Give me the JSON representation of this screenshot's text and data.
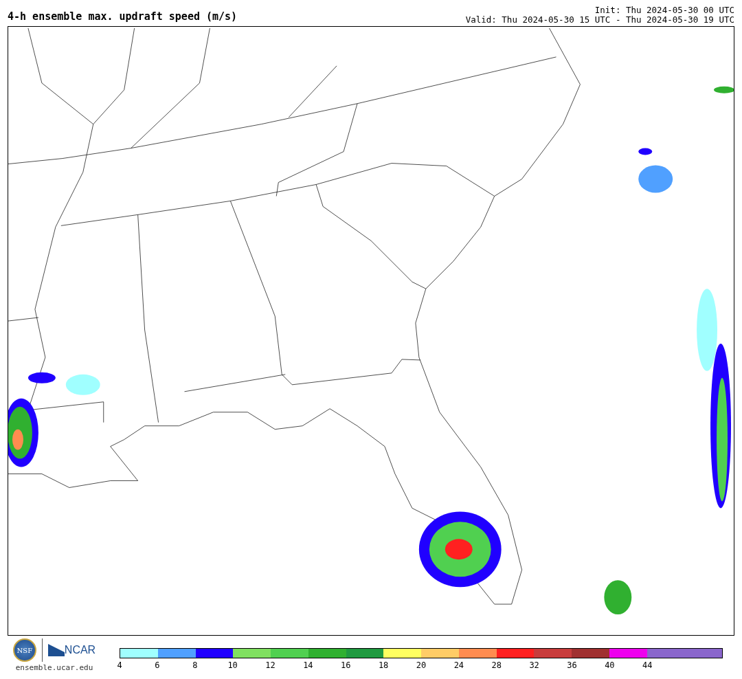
{
  "title": "4-h ensemble max. updraft speed (m/s)",
  "init": "Init: Thu 2024-05-30 00 UTC",
  "valid": "Valid: Thu 2024-05-30 15 UTC - Thu 2024-05-30 19 UTC",
  "footer": {
    "nsf_logo": "NSF",
    "ncar_logo": "NCAR",
    "url": "ensemble.ucar.edu"
  },
  "colorbar": [
    {
      "color": "#a0ffff",
      "label": "4"
    },
    {
      "color": "#50a0ff",
      "label": "6"
    },
    {
      "color": "#2000ff",
      "label": "8"
    },
    {
      "color": "#80e060",
      "label": "10"
    },
    {
      "color": "#50d050",
      "label": "12"
    },
    {
      "color": "#30b030",
      "label": "14"
    },
    {
      "color": "#209a40",
      "label": "16"
    },
    {
      "color": "#ffff60",
      "label": "18"
    },
    {
      "color": "#ffcc66",
      "label": "20"
    },
    {
      "color": "#ff8c50",
      "label": "24"
    },
    {
      "color": "#ff2020",
      "label": "28"
    },
    {
      "color": "#c83c3c",
      "label": "32"
    },
    {
      "color": "#a03030",
      "label": "36"
    },
    {
      "color": "#ee00ee",
      "label": "40"
    },
    {
      "color": "#8a66cc",
      "label": "44"
    },
    {
      "color": "#8a66cc"
    }
  ]
}
